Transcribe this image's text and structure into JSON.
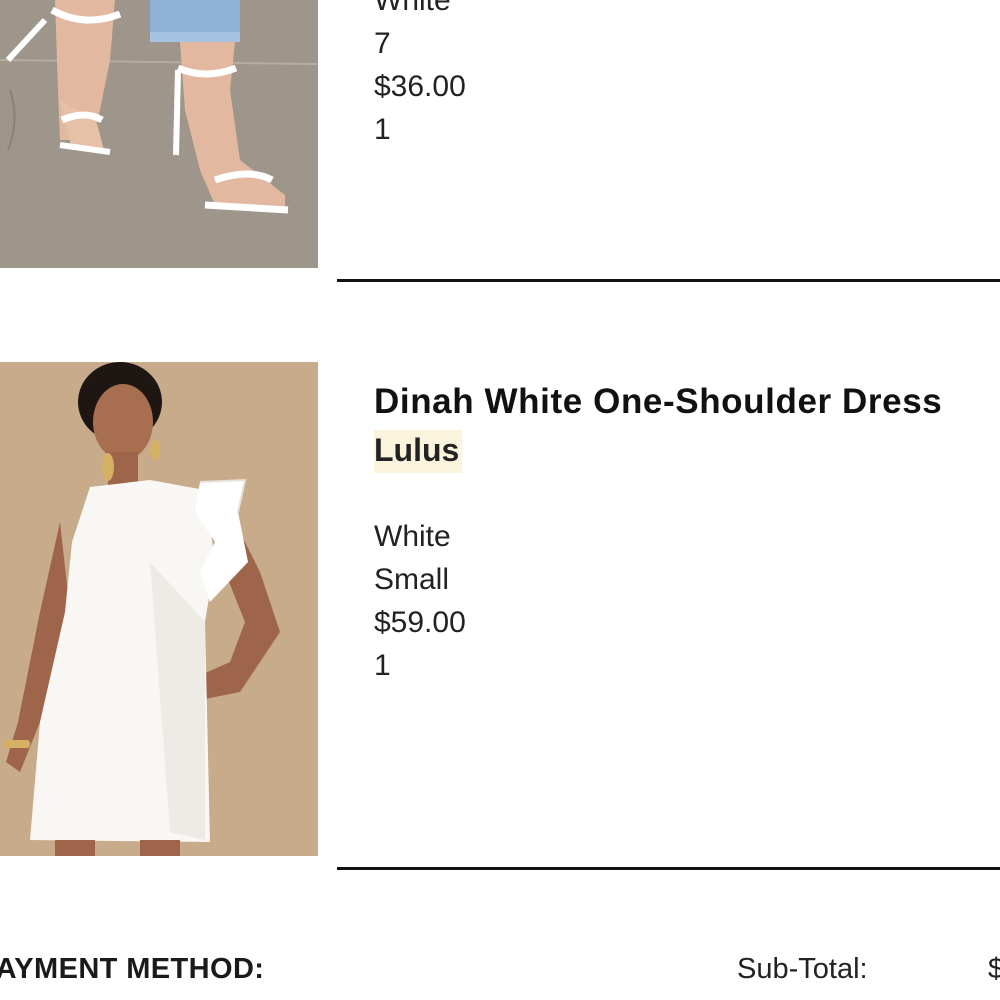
{
  "items": [
    {
      "image_alt": "White strappy heeled sandals",
      "color": "White",
      "size": "7",
      "price": "$36.00",
      "quantity": "1"
    },
    {
      "name": "Dinah White One-Shoulder Dress",
      "brand": "Lulus",
      "image_alt": "Model wearing white one-shoulder ruffle dress",
      "color": "White",
      "size": "Small",
      "price": "$59.00",
      "quantity": "1"
    }
  ],
  "footer": {
    "payment_method_label": "PAYMENT METHOD:",
    "subtotal_label": "Sub-Total:",
    "subtotal_value": "$"
  },
  "colors": {
    "brand_highlight": "#fbf4dc",
    "divider": "#111111",
    "text": "#222222"
  }
}
